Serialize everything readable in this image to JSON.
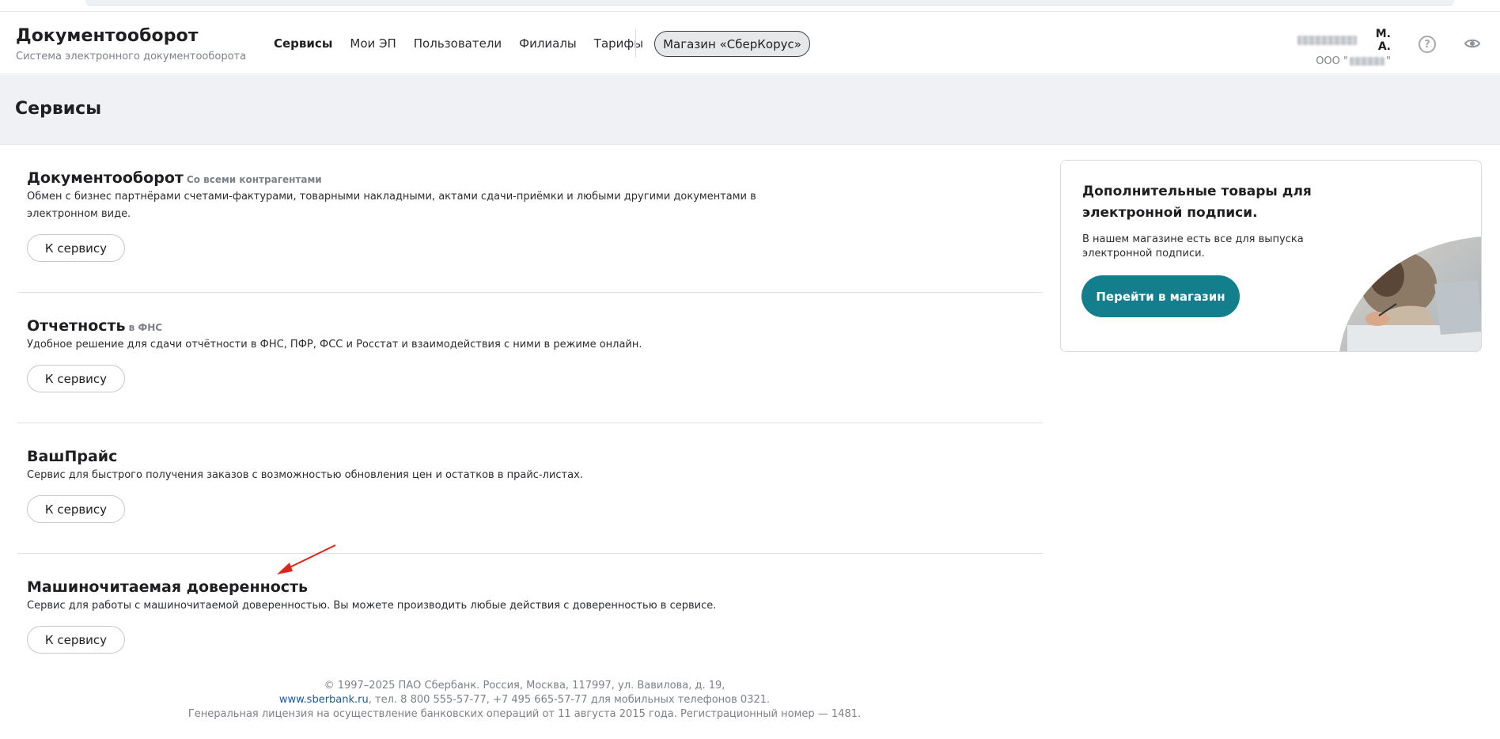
{
  "header": {
    "brand_title": "Документооборот",
    "brand_subtitle": "Система электронного документооборота",
    "nav": [
      {
        "label": "Сервисы",
        "active": true
      },
      {
        "label": "Мои ЭП",
        "active": false
      },
      {
        "label": "Пользователи",
        "active": false
      },
      {
        "label": "Филиалы",
        "active": false
      },
      {
        "label": "Тарифы",
        "active": false
      }
    ],
    "shop_button": "Магазин «СберКорус»",
    "user": {
      "name_visible": "М. А.",
      "org_prefix": "ООО \"",
      "org_suffix": "\""
    },
    "help_icon": "help-circle-icon",
    "view_icon": "eye-icon"
  },
  "page": {
    "title": "Сервисы"
  },
  "services": [
    {
      "name": "Документооборот",
      "tag": "Со всеми контрагентами",
      "description": "Обмен с бизнес партнёрами счетами-фактурами, товарными накладными, актами сдачи-приёмки и любыми другими документами в электронном виде.",
      "button": "К сервису"
    },
    {
      "name": "Отчетность",
      "tag": "в ФНС",
      "description": "Удобное решение для сдачи отчётности в ФНС, ПФР, ФСС и Росстат и взаимодействия с ними в режиме онлайн.",
      "button": "К сервису"
    },
    {
      "name": "ВашПрайс",
      "tag": "",
      "description": "Сервис для быстрого получения заказов с возможностью обновления цен и остатков в прайс-листах.",
      "button": "К сервису"
    },
    {
      "name": "Машиночитаемая доверенность",
      "tag": "",
      "description": "Сервис для работы с машиночитаемой доверенностью. Вы можете производить любые действия с доверенностью в сервисе.",
      "button": "К сервису"
    }
  ],
  "promo": {
    "title": "Дополнительные товары для электронной подписи.",
    "text": "В нашем магазине есть все для выпуска электронной подписи.",
    "button": "Перейти в магазин"
  },
  "footer": {
    "line1": "© 1997–2025 ПАО Сбербанк. Россия, Москва, 117997, ул. Вавилова, д. 19,",
    "link": "www.sberbank.ru",
    "line2_rest": ", тел. 8 800 555-57-77, +7 495 665-57-77 для мобильных телефонов 0321.",
    "line3": "Генеральная лицензия на осуществление банковских операций от 11 августа 2015 года. Регистрационный номер — 1481."
  },
  "colors": {
    "accent": "#137e8c",
    "annotation_arrow": "#e0241b",
    "link": "#1a5a9e"
  }
}
